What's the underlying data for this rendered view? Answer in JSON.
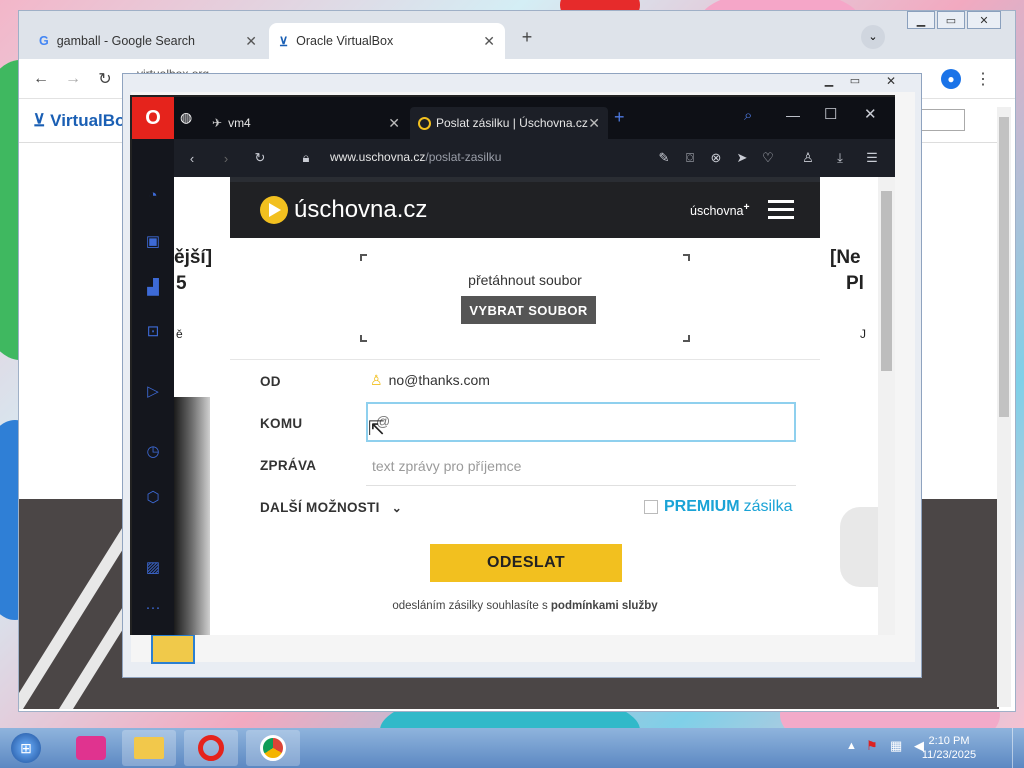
{
  "chrome": {
    "tabs": [
      {
        "title": "gamball - Google Search",
        "favicon": "google-g"
      },
      {
        "title": "Oracle VirtualBox",
        "favicon": "virtualbox-logo"
      }
    ],
    "new_tab": "+",
    "address": "virtualbox.org",
    "site_brand": "VirtualBox"
  },
  "opera": {
    "tabs": [
      {
        "title": "vm4"
      },
      {
        "title": "Poslat zásilku | Úschovna.cz"
      }
    ],
    "new_tab": "+",
    "url_host": "www.uschovna.cz",
    "url_path": "/poslat-zasilku",
    "sidebar_icons": [
      "speed-dial-icon",
      "shopping-bag-icon",
      "twitch-icon",
      "player-icon",
      "dash-icon",
      "play-circle-icon",
      "history-icon",
      "cube-icon",
      "wallet-icon",
      "gallery-icon",
      "more-icon"
    ]
  },
  "site": {
    "logo": "úschovna.cz",
    "nav_link": "úschovna",
    "nav_plus": "+",
    "drop_text": "přetáhnout soubor",
    "pick_button": "VYBRAT SOUBOR",
    "from_label": "OD",
    "from_value": "no@thanks.com",
    "to_label": "KOMU",
    "to_value": "@",
    "message_label": "ZPRÁVA",
    "message_placeholder": "text zprávy pro příjemce",
    "more_options": "DALŠÍ MOŽNOSTI",
    "premium_1": "PREMIUM",
    "premium_2": "zásilka",
    "send_button": "ODESLAT",
    "terms_prefix": "odesláním zásilky souhlasíte s",
    "terms_link": "podmínkami služby",
    "left_ad_1": "ější]",
    "left_ad_2": "5",
    "left_ad_3": "ě",
    "right_ad_1": "[Ne",
    "right_ad_2": "Pl",
    "right_ad_3": "J"
  },
  "taskbar": {
    "time": "2:10 PM",
    "date": "11/23/2025"
  },
  "colors": {
    "accent_yellow": "#f2c01f",
    "premium_blue": "#1aa3d6",
    "opera_red": "#e5231c"
  }
}
